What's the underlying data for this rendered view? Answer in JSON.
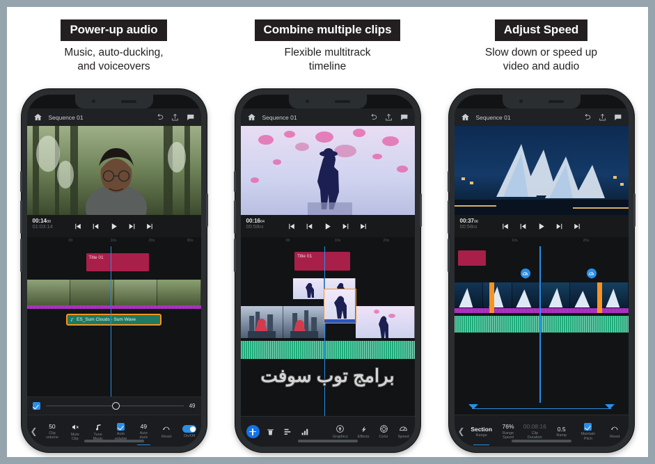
{
  "theme": {
    "page_border": "#95a4ad",
    "page_bg": "#ffffff",
    "badge_bg": "#231f20",
    "accent_blue": "#2a8fe8",
    "accent_orange": "#f79420",
    "title_clip": "#a81f4a",
    "audio_green": "#1d7a63",
    "waveform_green": "#1faa7a",
    "waveform_magenta": "#c43ad6"
  },
  "watermark": "برامج توب سوفت",
  "panels": [
    {
      "caption": {
        "badge": "Power-up audio",
        "sub": "Music, auto-ducking,\nand voiceovers"
      },
      "app": {
        "home_icon": "home-icon",
        "sequence": "Sequence 01",
        "undo_icon": "undo-icon",
        "share_icon": "share-icon",
        "comment_icon": "comment-icon"
      },
      "player": {
        "current_time": "00:14",
        "current_frames": "00",
        "duration": "01:03:14",
        "duration_frames": "14",
        "buttons": [
          "skip-to-start-icon",
          "step-back-icon",
          "play-icon",
          "step-forward-icon",
          "skip-to-end-icon"
        ]
      },
      "ruler_ticks": [
        "00",
        "10s",
        "20s",
        "30s"
      ],
      "timeline": {
        "title_clip": "Title 01",
        "audio_clip": "ES_Sum Clouds - Sum Wave",
        "audio_icon": "music-note-icon"
      },
      "slider": {
        "checked": true,
        "value": "49",
        "checkbox_name": "auto-duck-enable-checkbox"
      },
      "toolbar": {
        "back_icon": "chevron-left-icon",
        "items": [
          {
            "value": "50",
            "label": "Clip\nvolume",
            "type": "value",
            "name": "clip-volume-tool"
          },
          {
            "value": "",
            "label": "Mute\nClip",
            "type": "icon",
            "icon": "speaker-mute-icon",
            "name": "mute-clip-tool"
          },
          {
            "value": "",
            "label": "Tune\nMusic",
            "type": "icon",
            "icon": "music-note-icon",
            "name": "tune-music-tool"
          },
          {
            "value": "",
            "label": "Auto\nvolume",
            "type": "check",
            "name": "auto-volume-tool"
          },
          {
            "value": "49",
            "label": "Auto\nduck",
            "type": "value",
            "active": true,
            "name": "auto-duck-tool"
          },
          {
            "value": "",
            "label": "Reset",
            "type": "icon",
            "icon": "reset-icon",
            "name": "reset-tool"
          },
          {
            "value": "",
            "label": "On/Off",
            "type": "toggle",
            "name": "on-off-toggle"
          }
        ]
      }
    },
    {
      "caption": {
        "badge": "Combine multiple clips",
        "sub": "Flexible multitrack\ntimeline"
      },
      "app": {
        "home_icon": "home-icon",
        "sequence": "Sequence 01",
        "undo_icon": "undo-icon",
        "share_icon": "share-icon",
        "comment_icon": "comment-icon"
      },
      "player": {
        "current_time": "00:16",
        "current_frames": "04",
        "duration": "00:58",
        "duration_frames": "09",
        "buttons": [
          "skip-to-start-icon",
          "step-back-icon",
          "play-icon",
          "step-forward-icon",
          "skip-to-end-icon"
        ]
      },
      "ruler_ticks": [
        "00",
        "10s",
        "20s"
      ],
      "timeline": {
        "title_clip": "Title 01"
      },
      "toolbar2": {
        "add_label": "add-clip-button",
        "left_icons": [
          {
            "icon": "delete-icon",
            "name": "delete-tool"
          },
          {
            "icon": "layers-icon",
            "name": "layers-tool"
          },
          {
            "icon": "audio-levels-icon",
            "name": "audio-levels-tool"
          }
        ],
        "right_items": [
          {
            "icon": "graphics-icon",
            "label": "Graphics",
            "name": "graphics-tool"
          },
          {
            "icon": "effects-icon",
            "label": "Effects",
            "name": "effects-tool"
          },
          {
            "icon": "color-icon",
            "label": "Color",
            "name": "color-tool"
          },
          {
            "icon": "speed-icon",
            "label": "Speed",
            "name": "speed-tool"
          }
        ]
      }
    },
    {
      "caption": {
        "badge": "Adjust Speed",
        "sub": "Slow down or speed up\nvideo and audio"
      },
      "app": {
        "home_icon": "home-icon",
        "sequence": "Sequence 01",
        "undo_icon": "undo-icon",
        "share_icon": "share-icon",
        "comment_icon": "comment-icon"
      },
      "player": {
        "current_time": "00:37",
        "current_frames": "06",
        "duration": "00:58",
        "duration_frames": "09",
        "buttons": [
          "skip-to-start-icon",
          "step-back-icon",
          "play-icon",
          "step-forward-icon",
          "skip-to-end-icon"
        ]
      },
      "ruler_ticks": [
        "10s",
        "20s"
      ],
      "timeline": {
        "speed_badge_icon": "speedometer-icon"
      },
      "toolbar": {
        "back_icon": "chevron-left-icon",
        "items": [
          {
            "value": "Section",
            "label": "Range",
            "type": "value",
            "active": true,
            "strong": true,
            "name": "range-tool"
          },
          {
            "value": "76%",
            "label": "Range\nSpeed",
            "type": "value",
            "name": "range-speed-tool"
          },
          {
            "value": "00:08:16",
            "label": "Clip\nDuration",
            "type": "value",
            "dim": true,
            "name": "clip-duration-tool"
          },
          {
            "value": "0.5",
            "label": "Ramp",
            "type": "value",
            "name": "ramp-tool"
          },
          {
            "value": "",
            "label": "Maintain\nPitch",
            "type": "check",
            "name": "maintain-pitch-tool"
          },
          {
            "value": "",
            "label": "Reset",
            "type": "icon",
            "icon": "reset-icon",
            "name": "reset-tool"
          }
        ]
      }
    }
  ]
}
